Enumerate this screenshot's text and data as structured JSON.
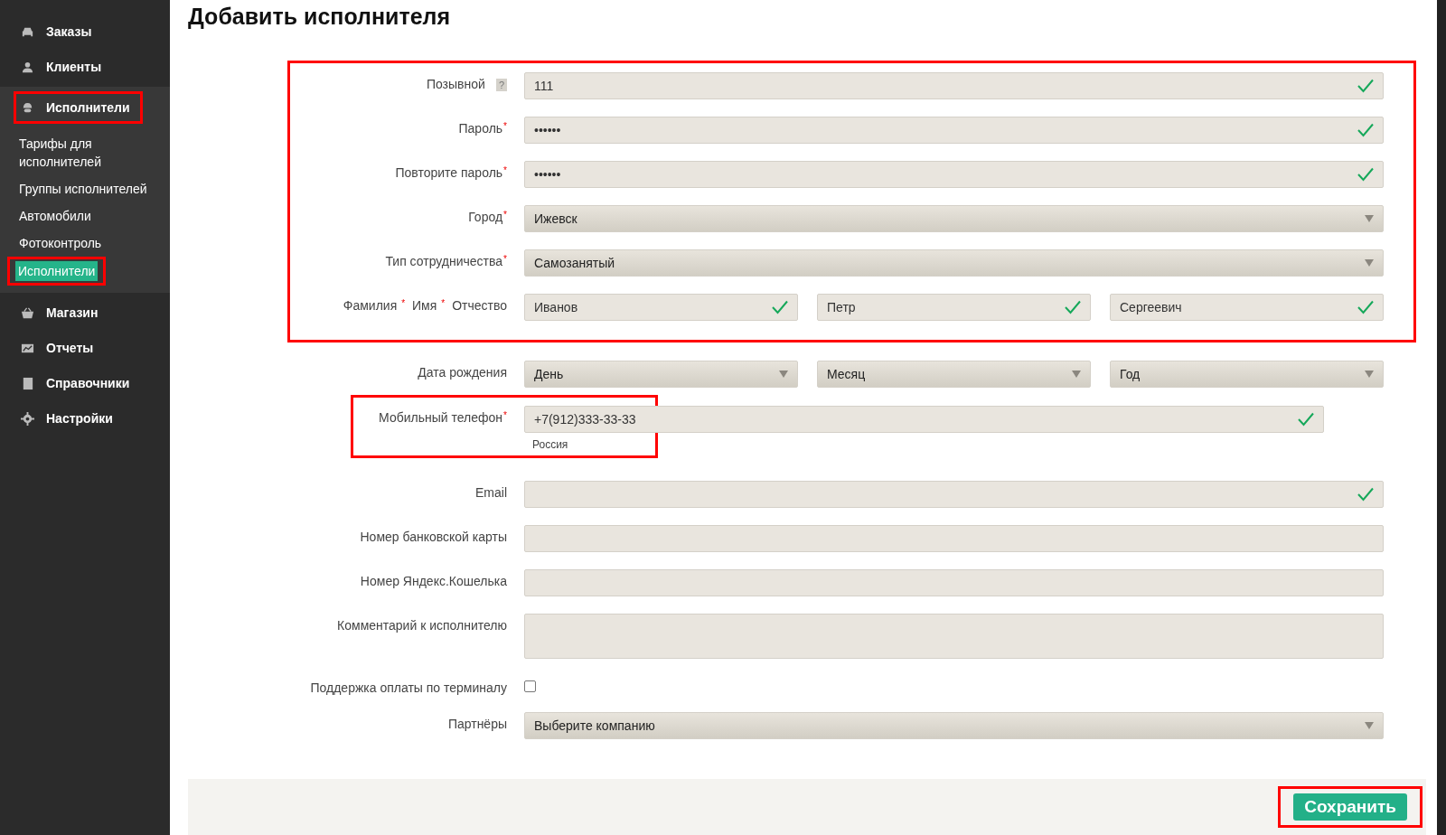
{
  "sidebar": {
    "items": [
      {
        "label": "Заказы",
        "selected": false
      },
      {
        "label": "Клиенты",
        "selected": false
      },
      {
        "label": "Исполнители",
        "selected": true,
        "highlighted": true,
        "children": [
          {
            "label": "Тарифы для исполнителей",
            "selected": false
          },
          {
            "label": "Группы исполнителей",
            "selected": false
          },
          {
            "label": "Автомобили",
            "selected": false
          },
          {
            "label": "Фотоконтроль",
            "selected": false
          },
          {
            "label": "Исполнители",
            "selected": true,
            "highlighted": true
          }
        ]
      },
      {
        "label": "Магазин",
        "selected": false
      },
      {
        "label": "Отчеты",
        "selected": false
      },
      {
        "label": "Справочники",
        "selected": false
      },
      {
        "label": "Настройки",
        "selected": false
      }
    ]
  },
  "page": {
    "title": "Добавить исполнителя"
  },
  "form": {
    "sections": [
      {
        "highlighted": true,
        "rows": [
          {
            "kind": "text",
            "labels": [
              "Позывной"
            ],
            "help": "?",
            "fields": [
              {
                "value": "111",
                "valid": true
              }
            ]
          },
          {
            "kind": "text",
            "labels": [
              "Пароль$^{*}$"
            ],
            "fields": [
              {
                "value": "••••••",
                "valid": true
              }
            ]
          },
          {
            "kind": "text",
            "labels": [
              "Повторите пароль$^{*}$"
            ],
            "fields": [
              {
                "value": "••••••",
                "valid": true
              }
            ]
          },
          {
            "kind": "select",
            "labels": [
              "Город$^{*}$"
            ],
            "fields": [
              {
                "value": "Ижевск"
              }
            ]
          },
          {
            "kind": "select",
            "labels": [
              "Тип сотрудничества$^{*}$"
            ],
            "fields": [
              {
                "value": "Самозанятый"
              }
            ]
          },
          {
            "kind": "text",
            "labels": [
              "Фамилия $^{*}$",
              "Имя $^{*}$",
              "Отчество"
            ],
            "fields": [
              {
                "value": "Иванов",
                "valid": true
              },
              {
                "value": "Петр",
                "valid": true
              },
              {
                "value": "Сергеевич",
                "valid": true
              }
            ]
          }
        ]
      },
      {
        "rows": [
          {
            "kind": "select",
            "labels": [
              "Дата рождения"
            ],
            "fields": [
              {
                "value": "День"
              },
              {
                "value": "Месяц"
              },
              {
                "value": "Год"
              }
            ]
          },
          {
            "kind": "phone",
            "highlighted": true,
            "labels": [
              "Мобильный телефон$^{*}$"
            ],
            "fields": [
              {
                "value": "+7(912)333-33-33",
                "valid": true
              }
            ],
            "note": "Россия"
          },
          {
            "kind": "text",
            "labels": [
              "Email"
            ],
            "fields": [
              {
                "valid": true
              }
            ]
          },
          {
            "kind": "text",
            "labels": [
              "Номер банковской карты"
            ]
          },
          {
            "kind": "text",
            "labels": [
              "Номер Яндекс.Кошелька"
            ]
          },
          {
            "kind": "textarea",
            "labels": [
              "Комментарий к исполнителю"
            ]
          },
          {
            "kind": "checkbox",
            "labels": [
              "Поддержка оплаты по терминалу"
            ],
            "checked": false
          },
          {
            "kind": "select",
            "labels": [
              "Партнёры"
            ],
            "fields": [
              {
                "value": "Выберите компанию"
              }
            ]
          }
        ]
      }
    ]
  },
  "footer": {
    "save_button": {
      "label": "Сохранить",
      "highlighted": true
    }
  }
}
